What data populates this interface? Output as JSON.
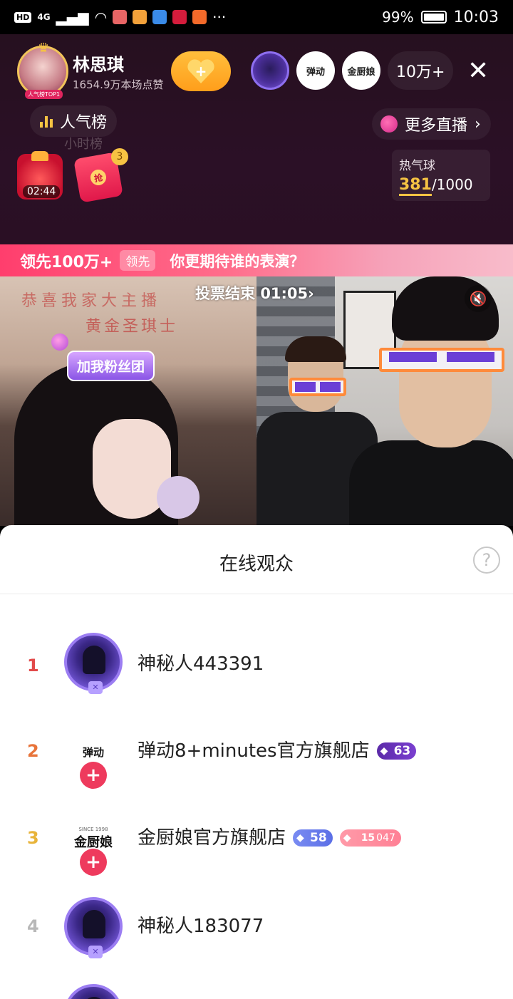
{
  "status_bar": {
    "hd": "HD",
    "net": "4G",
    "battery": "99%",
    "time": "10:03",
    "more": "···"
  },
  "host": {
    "name": "林思琪",
    "likes": "1654.9万本场点赞",
    "tag": "人气榜TOP1",
    "follow_label": "+"
  },
  "viewers": {
    "items": [
      "弹动",
      "金厨娘"
    ],
    "count": "10万+"
  },
  "rank": {
    "label": "人气榜",
    "sub": "小时榜"
  },
  "more_live": {
    "label": "更多直播",
    "chevron": "›"
  },
  "gifts": {
    "timer": "02:44",
    "redpack_char": "抢",
    "redpack_count": "3"
  },
  "hot_balloon": {
    "label": "热气球",
    "current": "381",
    "max": "/1000"
  },
  "pk": {
    "lead": "领先100万+",
    "tag": "领先",
    "question": "你更期待谁的表演？",
    "vote_label": "投票结束",
    "vote_time": "01:05"
  },
  "video": {
    "fan_button": "加我粉丝团",
    "wall_text": "恭喜我家大主播",
    "wall_text2": "黄金圣琪士"
  },
  "panel": {
    "title": "在线观众",
    "help": "?"
  },
  "audience": [
    {
      "rank": "1",
      "name": "神秘人443391",
      "rank_color": "#e24a4a"
    },
    {
      "rank": "2",
      "name": "弹动8+minutes官方旗舰店",
      "rank_color": "#e8743a",
      "avatar_text": "弹动",
      "level": "63"
    },
    {
      "rank": "3",
      "name": "金厨娘官方旗舰店",
      "rank_color": "#e8b43a",
      "avatar_text": "金厨娘",
      "avatar_sub": "SINCE 1998",
      "level": "58",
      "fan_level": "15",
      "fan_extra": "047"
    },
    {
      "rank": "4",
      "name": "神秘人183077",
      "rank_color": "#b8b8b8"
    }
  ],
  "icons": {
    "close": "close-icon",
    "mute": "mute-icon",
    "help": "help-icon"
  }
}
